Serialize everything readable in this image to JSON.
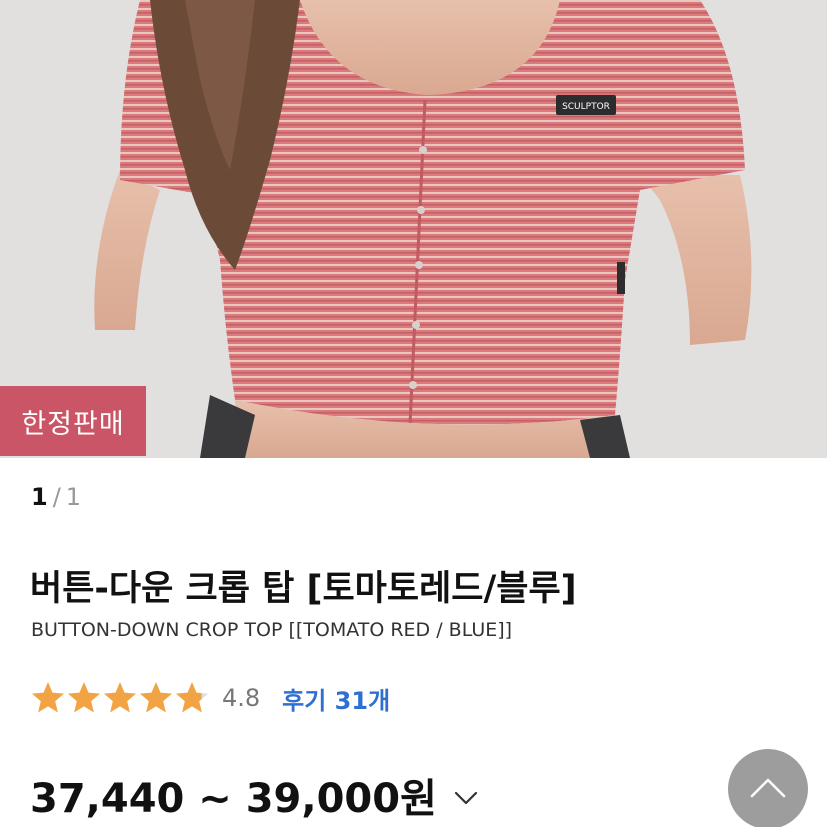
{
  "product_image": {
    "badge_label": "한정판매",
    "patch_text": "SCULPTOR"
  },
  "pager": {
    "current": "1",
    "separator": "/",
    "total": "1"
  },
  "product": {
    "title_ko": "버튼-다운 크롭 탑 [토마토레드/블루]",
    "title_en": "BUTTON-DOWN CROP TOP [[TOMATO RED / BLUE]]"
  },
  "rating": {
    "stars": 4.8,
    "max_stars": 5,
    "value_text": "4.8",
    "reviews_label": "후기 31개",
    "star_color": "#f2a444"
  },
  "price": {
    "range_text": "37,440 ~ 39,000원"
  },
  "icons": {
    "price_toggle": "chevron-down-icon",
    "scroll_top": "chevron-up-icon"
  },
  "colors": {
    "badge": "#c95566",
    "review_link": "#2f6fd1",
    "scroll_button": "#9d9d9d"
  }
}
